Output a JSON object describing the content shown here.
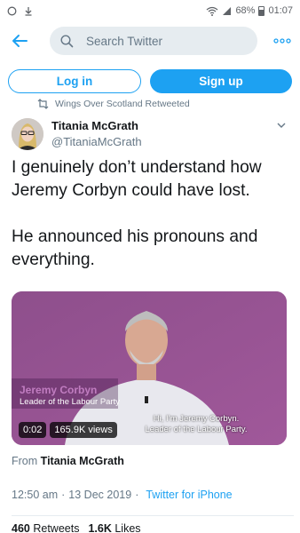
{
  "status_bar": {
    "battery_percent": "68%",
    "time": "01:07",
    "left_icons": [
      "notification-circle-icon",
      "download-icon"
    ],
    "right_icons": [
      "wifi-icon",
      "signal-icon",
      "battery-icon"
    ]
  },
  "top_bar": {
    "search_placeholder": "Search Twitter",
    "more_glyph": "∘∘∘",
    "accent": "#1da1f2"
  },
  "auth": {
    "login_label": "Log in",
    "signup_label": "Sign up"
  },
  "retweet_context": "Wings Over Scotland Retweeted",
  "tweet": {
    "display_name": "Titania McGrath",
    "handle": "@TitaniaMcGrath",
    "text_line_1": "I genuinely don’t understand how Jeremy Corbyn could have lost.",
    "text_line_2": "He announced his pronouns and everything.",
    "video": {
      "lower_third_name": "Jeremy Corbyn",
      "lower_third_role": "Leader of the Labour Party",
      "subtitle_1": "Hi, I’m Jeremy Corbyn.",
      "subtitle_2": "Leader of the Labour Party.",
      "duration": "0:02",
      "views": "165.9K views"
    },
    "from_prefix": "From",
    "from_name": "Titania McGrath",
    "time": "12:50 am",
    "separator": "·",
    "date": "13 Dec 2019",
    "source_separator": "·",
    "source_app": "Twitter for iPhone",
    "retweets_count": "460",
    "retweets_label": "Retweets",
    "likes_count": "1.6K",
    "likes_label": "Likes"
  }
}
